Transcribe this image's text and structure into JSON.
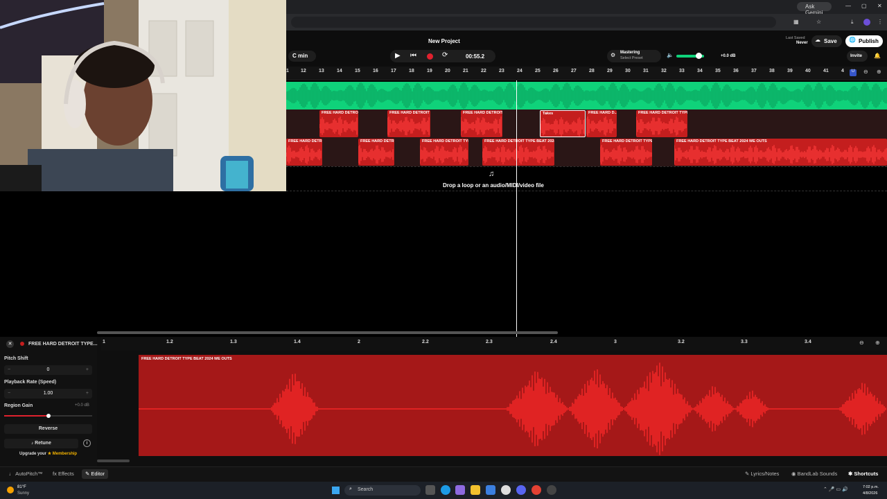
{
  "browser": {
    "gemini_label": "Ask Gemini"
  },
  "header": {
    "project_title": "New Project",
    "key": "C min",
    "time": "00:55.2",
    "mastering_label": "Mastering",
    "mastering_sub": "Select Preset",
    "volume_db": "+0.0 dB",
    "last_saved_label": "Last Saved",
    "last_saved_value": "Never",
    "save_label": "Save",
    "publish_label": "Publish",
    "invite_label": "Invite"
  },
  "ruler": [
    "1",
    "12",
    "13",
    "14",
    "15",
    "16",
    "17",
    "18",
    "19",
    "20",
    "21",
    "22",
    "23",
    "24",
    "25",
    "26",
    "27",
    "28",
    "29",
    "30",
    "31",
    "32",
    "33",
    "34",
    "35",
    "36",
    "37",
    "38",
    "39",
    "40",
    "41",
    "4"
  ],
  "tracks": {
    "track2_regions": [
      "FREE HARD DETRO...",
      "FREE HARD DETROIT ...",
      "FREE HARD DETROIT ...",
      "Takes",
      "FREE H...",
      "FREE HARD D...",
      "FREE HARD DETROIT TYPE ..."
    ],
    "track3_regions": [
      "FREE HARD DETR...",
      "FREE HARD DETROIT TYP...",
      "FREE HARD DETROIT TYPE BEAT 2024 ...",
      "FREE HARD DETROIT TYPE ...",
      "FREE HARD DETROIT TYPE BEAT 2024 WE OUTS"
    ],
    "drop_hint": "Drop a loop or an audio/MIDI/video file"
  },
  "editor": {
    "region_title": "FREE HARD DETROIT TYPE...",
    "pitch_shift_label": "Pitch Shift",
    "pitch_shift_value": "0",
    "playback_rate_label": "Playback Rate (Speed)",
    "playback_rate_value": "1.00",
    "region_gain_label": "Region Gain",
    "region_gain_value": "+0.0 dB",
    "region_gain_level": 0.5,
    "reverse_label": "Reverse",
    "retune_label": "Retune",
    "upgrade_text": "Upgrade your",
    "membership_text": "Membership",
    "ruler": [
      "1",
      "1.2",
      "1.3",
      "1.4",
      "2",
      "2.2",
      "2.3",
      "2.4",
      "3",
      "3.2",
      "3.3",
      "3.4"
    ],
    "wave_label": "FREE HARD DETROIT TYPE BEAT 2024 WE OUTS"
  },
  "footer": {
    "autopitch": "AutoPitch™",
    "effects": "Effects",
    "editor": "Editor",
    "lyrics": "Lyrics/Notes",
    "sounds": "BandLab Sounds",
    "shortcuts": "Shortcuts"
  },
  "taskbar": {
    "temp": "81°F",
    "weather": "Sunny",
    "search": "Search",
    "time": "7:02 p.m.",
    "date": "4/8/2026"
  },
  "colors": {
    "green_track": "#0fd27a",
    "red_region": "#c41e1e",
    "accent": "#f5b400"
  }
}
